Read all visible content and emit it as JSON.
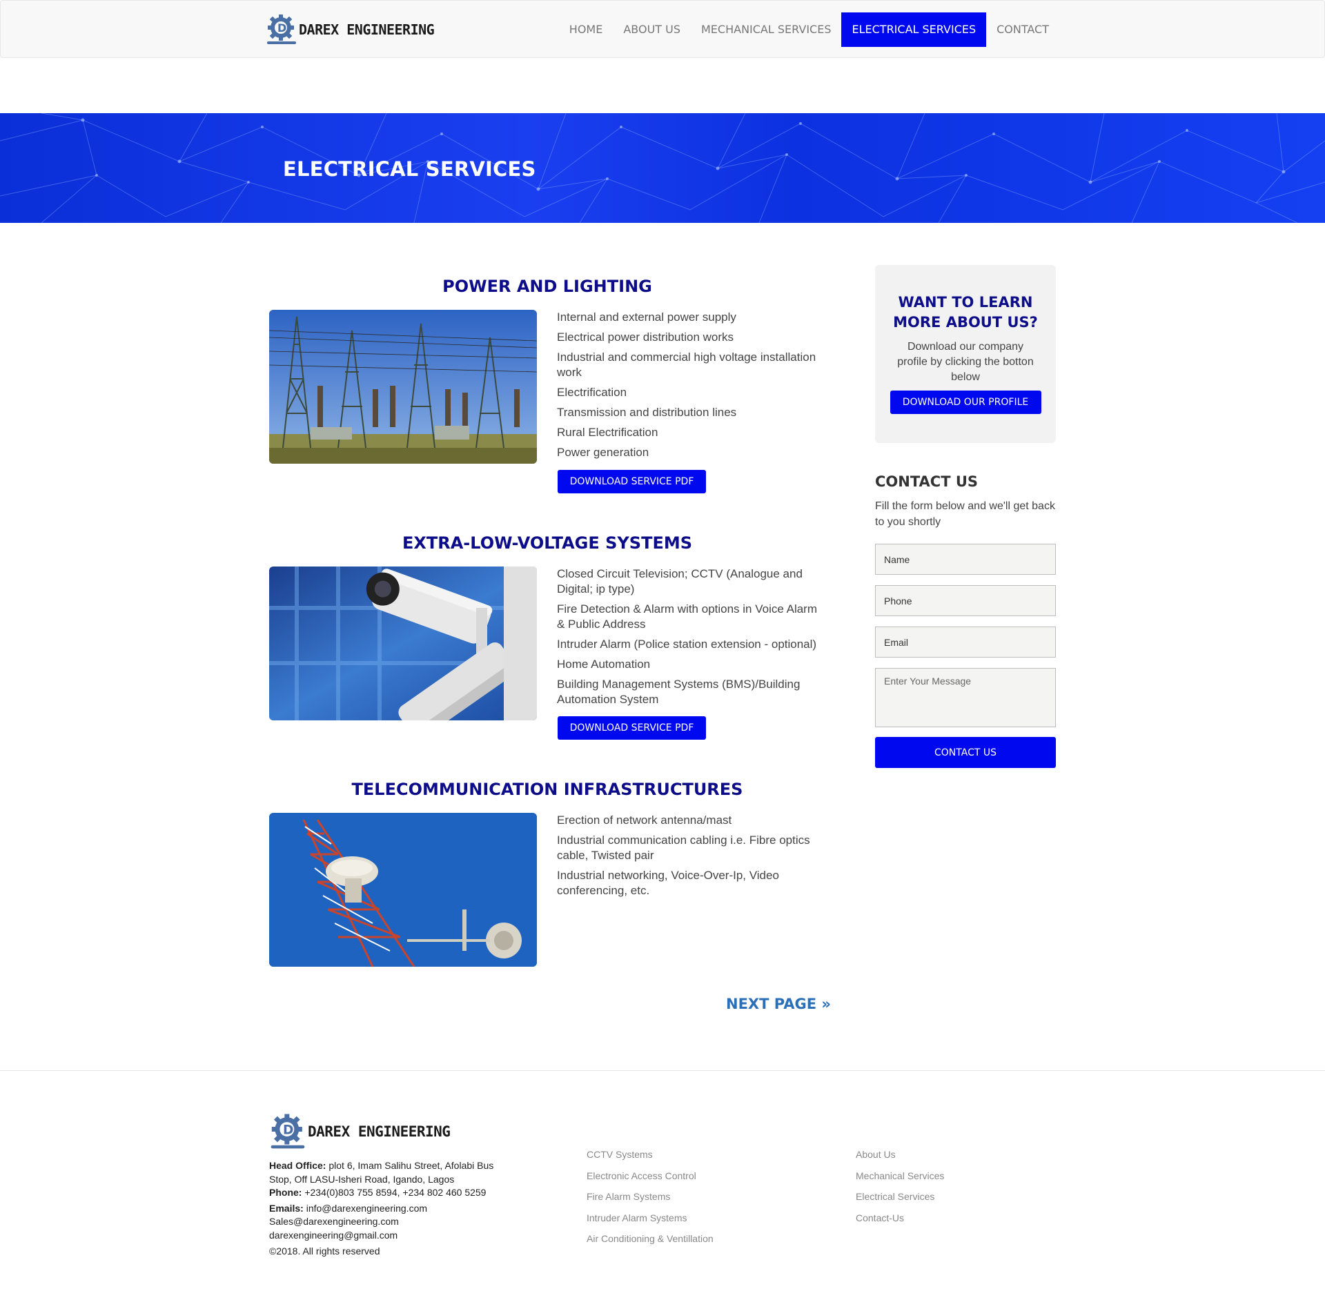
{
  "brand": {
    "name": "DAREX ENGINEERING"
  },
  "nav": [
    {
      "label": "HOME",
      "active": false
    },
    {
      "label": "ABOUT US",
      "active": false
    },
    {
      "label": "MECHANICAL SERVICES",
      "active": false
    },
    {
      "label": "ELECTRICAL SERVICES",
      "active": true
    },
    {
      "label": "CONTACT",
      "active": false
    }
  ],
  "hero": {
    "title": "ELECTRICAL SERVICES"
  },
  "services": [
    {
      "title": "POWER AND LIGHTING",
      "image": "electrical-substation-photo",
      "items": [
        "Internal and external power supply",
        "Electrical power distribution works",
        "Industrial and commercial high voltage installation work",
        "Electrification",
        "Transmission and distribution lines",
        "Rural Electrification",
        "Power generation"
      ],
      "button": "DOWNLOAD SERVICE PDF"
    },
    {
      "title": "EXTRA-LOW-VOLTAGE SYSTEMS",
      "image": "cctv-cameras-photo",
      "items": [
        "Closed Circuit Television; CCTV (Analogue and Digital; ip type)",
        "Fire Detection & Alarm with options in Voice Alarm & Public Address",
        "Intruder Alarm (Police station extension - optional)",
        "Home Automation",
        "Building Management Systems (BMS)/Building Automation System"
      ],
      "button": "DOWNLOAD SERVICE PDF"
    },
    {
      "title": "TELECOMMUNICATION INFRASTRUCTURES",
      "image": "telecom-tower-photo",
      "items": [
        "Erection of network antenna/mast",
        "Industrial communication cabling i.e. Fibre optics cable, Twisted pair",
        "Industrial networking, Voice-Over-Ip, Video conferencing, etc."
      ]
    }
  ],
  "next_page": "NEXT PAGE »",
  "sidebar": {
    "learn_title": "WANT TO LEARN MORE ABOUT US?",
    "learn_text": "Download our company profile by clicking the botton below",
    "learn_button": "DOWNLOAD OUR PROFILE",
    "contact_title": "CONTACT US",
    "contact_text": "Fill the form below and we'll get back to you shortly",
    "fields": {
      "name": "Name",
      "phone": "Phone",
      "email": "Email",
      "message": "Enter Your Message"
    },
    "contact_button": "CONTACT US"
  },
  "footer": {
    "brand": "DAREX ENGINEERING",
    "head_office_label": "Head Office:",
    "head_office": "plot 6, Imam Salihu Street, Afolabi Bus Stop, Off LASU-Isheri Road, Igando, Lagos",
    "phone_label": "Phone:",
    "phone": "+234(0)803 755 8594, +234 802 460 5259",
    "emails_label": "Emails:",
    "email1": "info@darexengineering.com",
    "email2": "Sales@darexengineering.com",
    "email3": "darexengineering@gmail.com",
    "copyright": "©2018. All rights reserved",
    "col1": [
      "CCTV Systems",
      "Electronic Access Control",
      "Fire Alarm Systems",
      "Intruder Alarm Systems",
      "Air Conditioning & Ventillation"
    ],
    "col2": [
      "About Us",
      "Mechanical Services",
      "Electrical Services",
      "Contact-Us"
    ]
  },
  "colors": {
    "primary": "#0008f0",
    "heading": "#0d0d8a",
    "link": "#2a6fb8",
    "hero": "#1a3ff0"
  }
}
